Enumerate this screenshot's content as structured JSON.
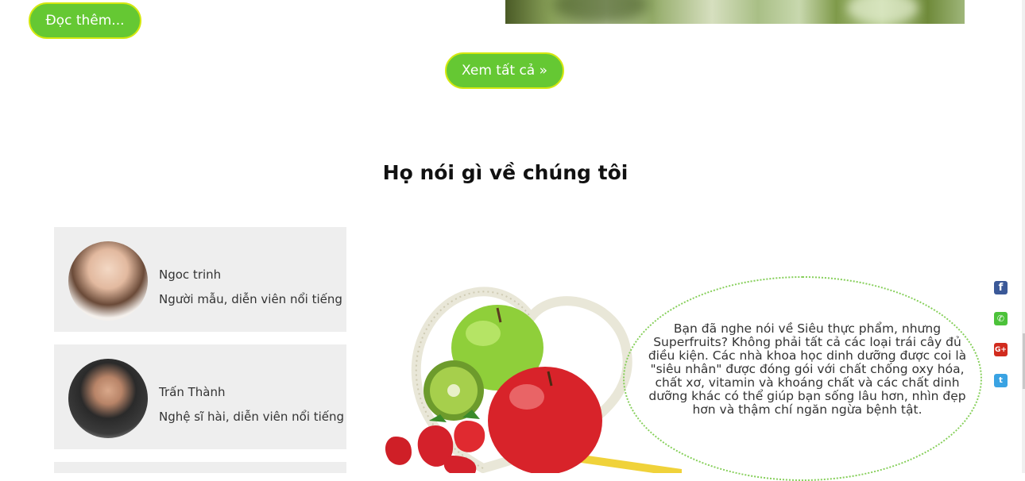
{
  "buttons": {
    "read_more": "Đọc thêm...",
    "view_all": "Xem tất cả »"
  },
  "section": {
    "title": "Họ nói gì về chúng tôi"
  },
  "testimonials": [
    {
      "name": "Ngoc trinh",
      "role": "Người mẫu, diễn viên nổi tiếng"
    },
    {
      "name": "Trấn Thành",
      "role": "Nghệ sĩ hài, diễn viên nổi tiếng"
    }
  ],
  "quote": {
    "lines": [
      "Bạn đã nghe nói về Siêu thực phẩm, nhưng",
      "Superfruits? Không phải tất cả các loại trái cây đủ",
      "điều kiện. Các nhà khoa học dinh dưỡng được coi là",
      "\"siêu nhân\" được đóng gói với chất chống oxy hóa,",
      "chất xơ, vitamin và khoáng chất và các chất dinh",
      "dưỡng khác có thể giúp bạn sống lâu hơn, nhìn đẹp",
      "hơn và thậm chí ngăn ngừa bệnh tật."
    ]
  },
  "social": {
    "facebook": "f",
    "phone": "✆",
    "google_plus": "G+",
    "twitter": "t"
  },
  "colors": {
    "accent_green": "#65c833",
    "button_border": "#d4e80f",
    "card_bg": "#eeeeee"
  }
}
